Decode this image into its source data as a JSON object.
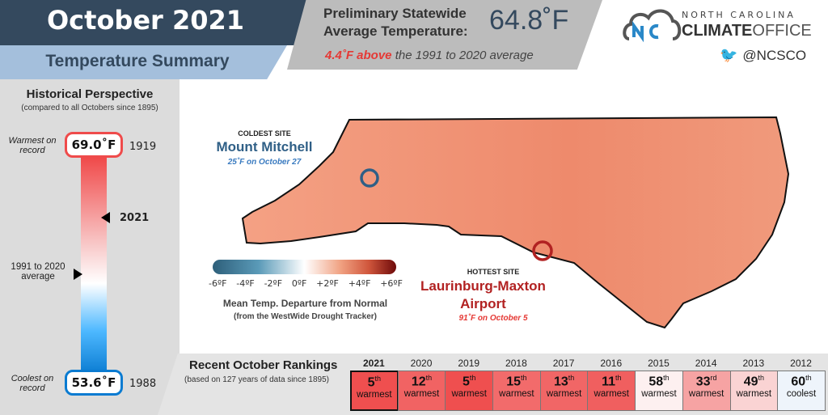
{
  "header": {
    "title": "October 2021",
    "subtitle": "Temperature Summary"
  },
  "statewide": {
    "label_line1": "Preliminary Statewide",
    "label_line2": "Average Temperature:",
    "value": "64.8˚F",
    "anomaly_hot": "4.4˚F above",
    "anomaly_rest": " the 1991 to 2020 average"
  },
  "logo": {
    "line1": "NORTH CAROLINA",
    "bold": "CLIMATE",
    "light": "OFFICE",
    "twitter": "@NCSCO",
    "twitter_icon": "twitter-bird-icon"
  },
  "historical": {
    "title": "Historical Perspective",
    "subtitle": "(compared to all Octobers since 1895)",
    "warmest_label": "Warmest on record",
    "warmest_value": "69.0˚F",
    "warmest_year": "1919",
    "coolest_label": "Coolest on record",
    "coolest_value": "53.6˚F",
    "coolest_year": "1988",
    "current_year": "2021",
    "average_label": "1991 to 2020 average",
    "current_value_f": 64.8,
    "average_value_f": 60.4
  },
  "map": {
    "coldest": {
      "heading": "COLDEST SITE",
      "name": "Mount Mitchell",
      "detail": "25˚F on October 27"
    },
    "hottest": {
      "heading": "HOTTEST SITE",
      "name": "Laurinburg-Maxton Airport",
      "detail": "91˚F on October 5"
    },
    "legend": {
      "ticks": [
        "-6ºF",
        "-4ºF",
        "-2ºF",
        "0ºF",
        "+2ºF",
        "+4ºF",
        "+6ºF"
      ],
      "title": "Mean Temp. Departure from Normal",
      "source": "(from the WestWide Drought Tracker)"
    }
  },
  "rankings": {
    "title": "Recent October Rankings",
    "subtitle": "(based on 127 years of data since 1895)",
    "items": [
      {
        "year": "2021",
        "rank": "5",
        "suffix": "th",
        "label": "warmest",
        "color": "#ef4f4f"
      },
      {
        "year": "2020",
        "rank": "12",
        "suffix": "th",
        "label": "warmest",
        "color": "#f16363"
      },
      {
        "year": "2019",
        "rank": "5",
        "suffix": "th",
        "label": "warmest",
        "color": "#ef4f4f"
      },
      {
        "year": "2018",
        "rank": "15",
        "suffix": "th",
        "label": "warmest",
        "color": "#f26b6b"
      },
      {
        "year": "2017",
        "rank": "13",
        "suffix": "th",
        "label": "warmest",
        "color": "#f16666"
      },
      {
        "year": "2016",
        "rank": "11",
        "suffix": "th",
        "label": "warmest",
        "color": "#f05f5f"
      },
      {
        "year": "2015",
        "rank": "58",
        "suffix": "th",
        "label": "warmest",
        "color": "#fdf0f0"
      },
      {
        "year": "2014",
        "rank": "33",
        "suffix": "rd",
        "label": "warmest",
        "color": "#f6a3a3"
      },
      {
        "year": "2013",
        "rank": "49",
        "suffix": "th",
        "label": "warmest",
        "color": "#fad3d3"
      },
      {
        "year": "2012",
        "rank": "60",
        "suffix": "th",
        "label": "coolest",
        "color": "#eef4fb"
      }
    ]
  }
}
